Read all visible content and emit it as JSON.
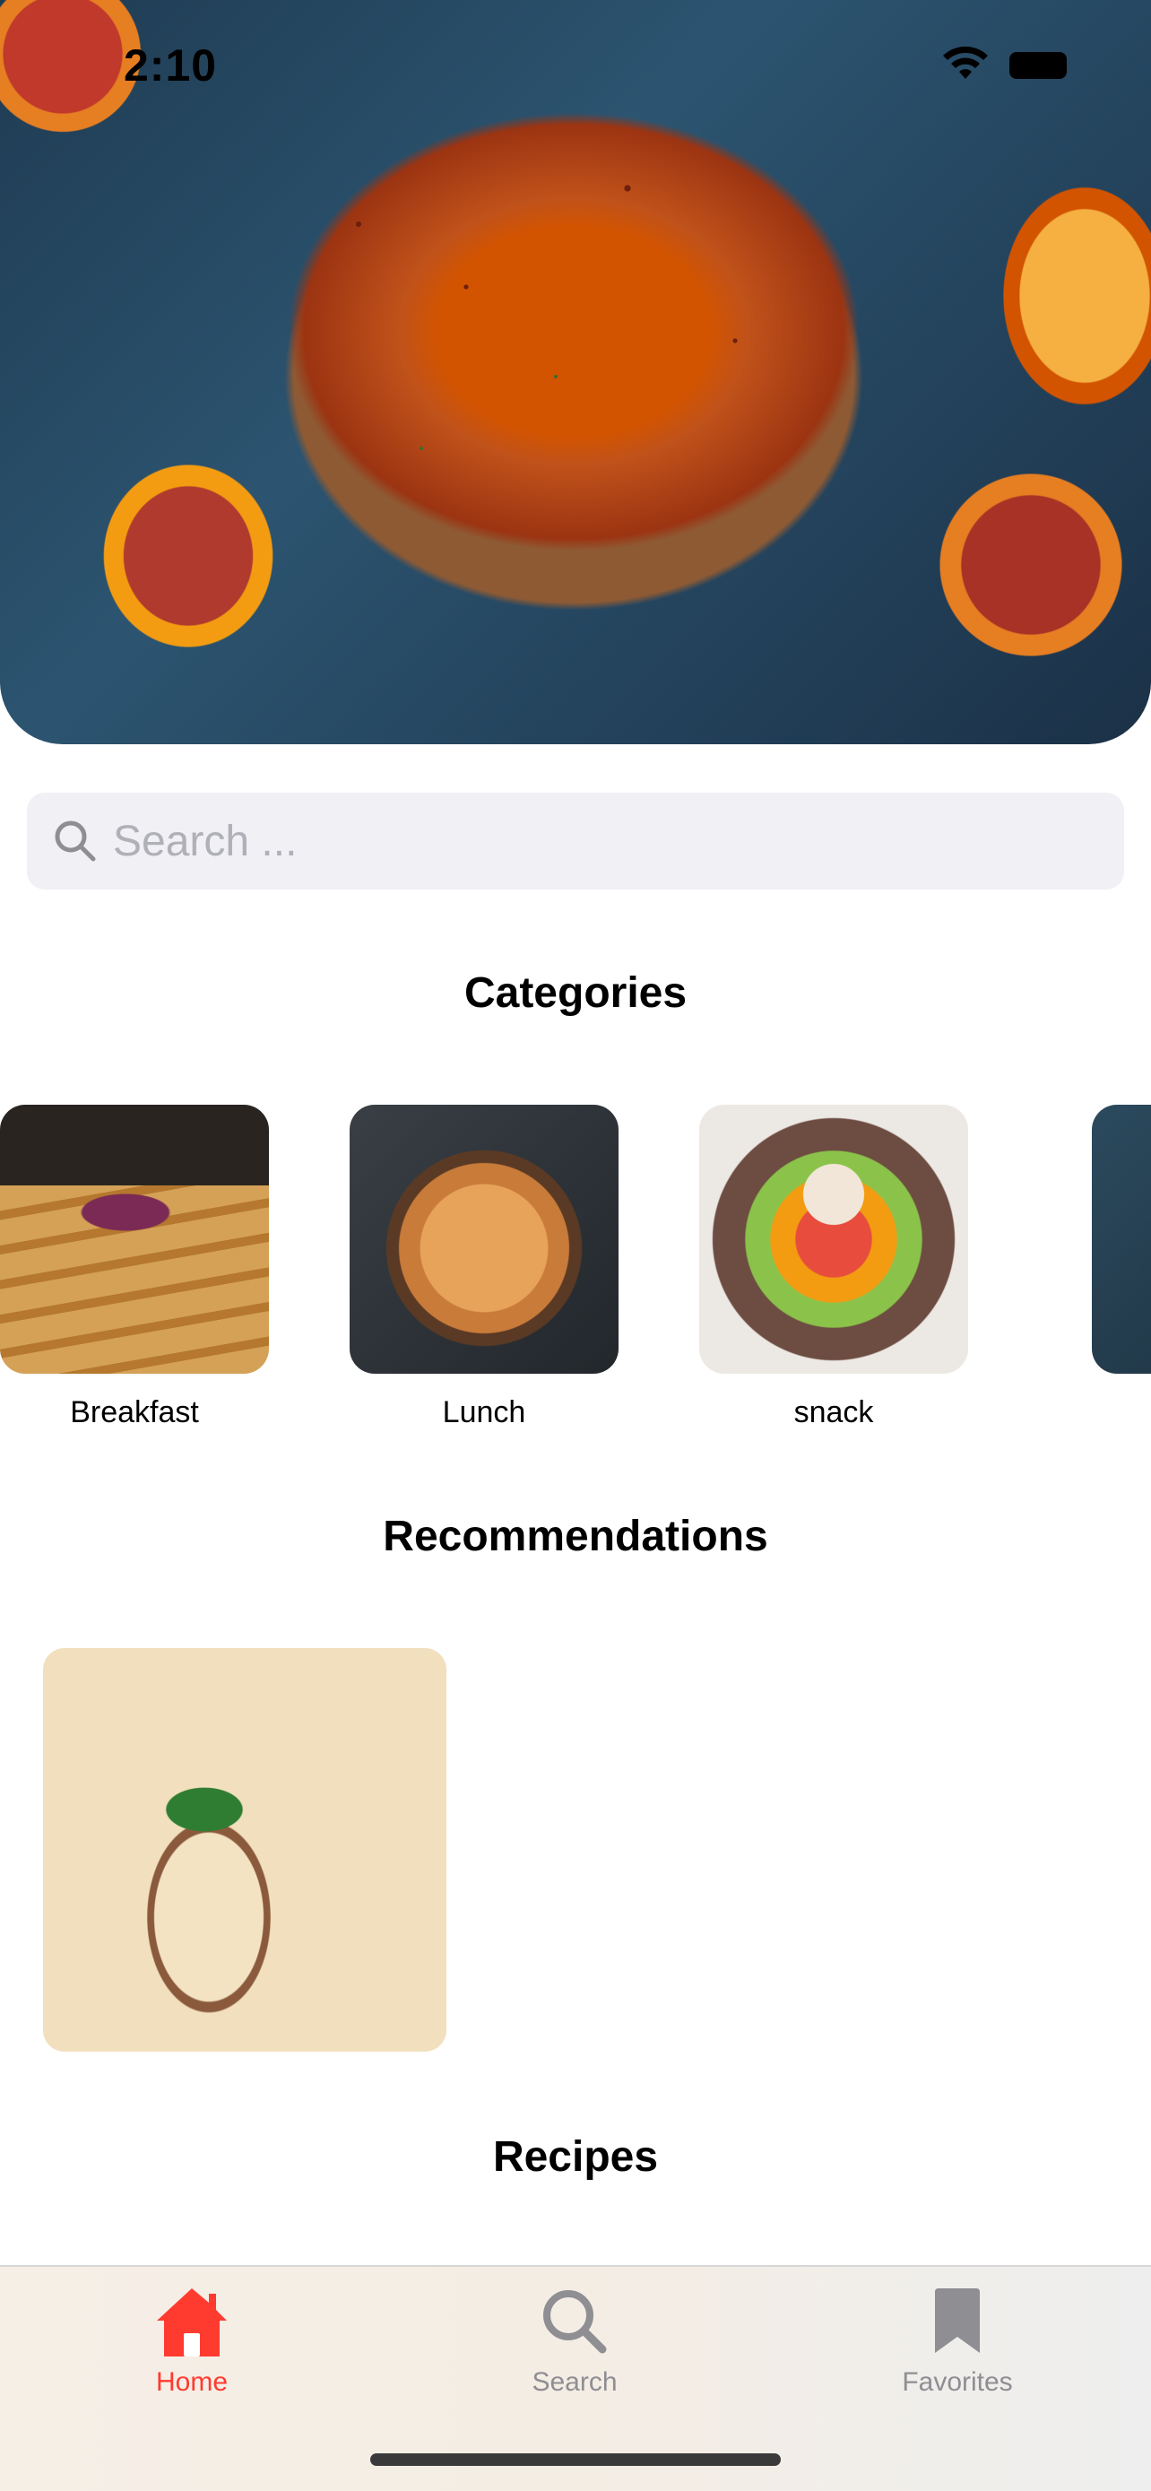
{
  "status_bar": {
    "time": "2:10"
  },
  "search": {
    "placeholder": "Search ..."
  },
  "sections": {
    "categories_title": "Categories",
    "recommendations_title": "Recommendations",
    "recipes_title": "Recipes"
  },
  "categories": [
    {
      "label": "Breakfast"
    },
    {
      "label": "Lunch"
    },
    {
      "label": "snack"
    }
  ],
  "tabs": [
    {
      "label": "Home",
      "icon": "house-icon",
      "active": true
    },
    {
      "label": "Search",
      "icon": "magnifier-icon",
      "active": false
    },
    {
      "label": "Favorites",
      "icon": "bookmark-icon",
      "active": false
    }
  ],
  "colors": {
    "accent": "#ff3b30",
    "inactive": "#8e8e93",
    "search_bg": "#f0f0f5"
  }
}
